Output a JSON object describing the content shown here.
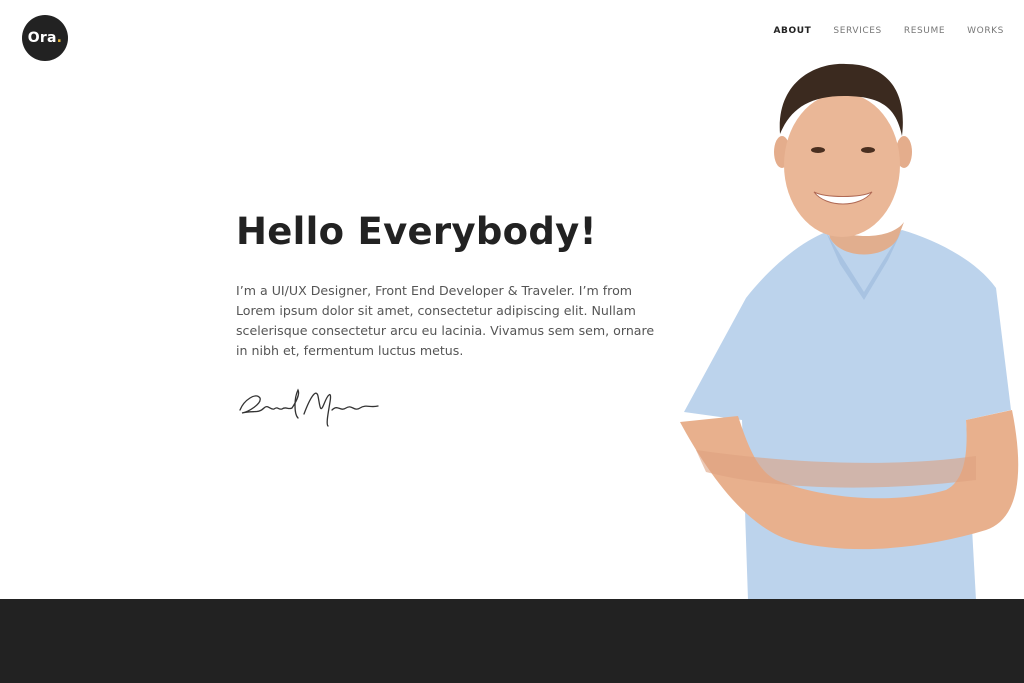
{
  "brand": {
    "logo_text": "Ora",
    "logo_dot": ".",
    "accent": "#e7b63a",
    "dark": "#222222"
  },
  "nav": {
    "items": [
      {
        "label": "ABOUT"
      },
      {
        "label": "SERVICES"
      },
      {
        "label": "RESUME"
      },
      {
        "label": "WORKS"
      }
    ]
  },
  "hero": {
    "title": "Hello Everybody!",
    "intro": "I’m a UI/UX Designer, Front End Developer & Traveler. I’m from Lorem ipsum dolor sit amet, consectetur adipiscing elit. Nullam scelerisque consectetur arcu eu lacinia. Vivamus sem sem, ornare in nibh et, fermentum luctus metus.",
    "signature_text": "Richard Nixon"
  },
  "icons": {
    "logo": "ora-logo-icon",
    "signature": "signature-icon",
    "portrait": "person-portrait-icon"
  }
}
